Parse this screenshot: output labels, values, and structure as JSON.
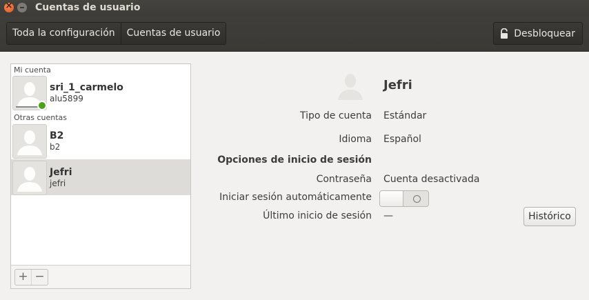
{
  "window": {
    "title": "Cuentas de usuario"
  },
  "toolbar": {
    "breadcrumb": [
      "Toda la configuración",
      "Cuentas de usuario"
    ],
    "unlock_label": "Desbloquear"
  },
  "sidebar": {
    "my_account_label": "Mi cuenta",
    "other_accounts_label": "Otras cuentas",
    "my_account": {
      "name": "sri_1_carmelo",
      "login": "alu5899",
      "online": true
    },
    "others": [
      {
        "name": "B2",
        "login": "b2",
        "selected": false
      },
      {
        "name": "Jefri",
        "login": "jefri",
        "selected": true
      }
    ],
    "add_label": "+",
    "remove_label": "−"
  },
  "details": {
    "name": "Jefri",
    "account_type_label": "Tipo de cuenta",
    "account_type_value": "Estándar",
    "language_label": "Idioma",
    "language_value": "Español",
    "login_options_heading": "Opciones de inicio de sesión",
    "password_label": "Contraseña",
    "password_value": "Cuenta desactivada",
    "autologin_label": "Iniciar sesión automáticamente",
    "autologin_enabled": false,
    "last_login_label": "Último inicio de sesión",
    "last_login_value": "—",
    "history_button": "Histórico"
  },
  "colors": {
    "online": "#4ca31a",
    "close_button": "#e0561f",
    "selected_row": "#dedcd8"
  }
}
